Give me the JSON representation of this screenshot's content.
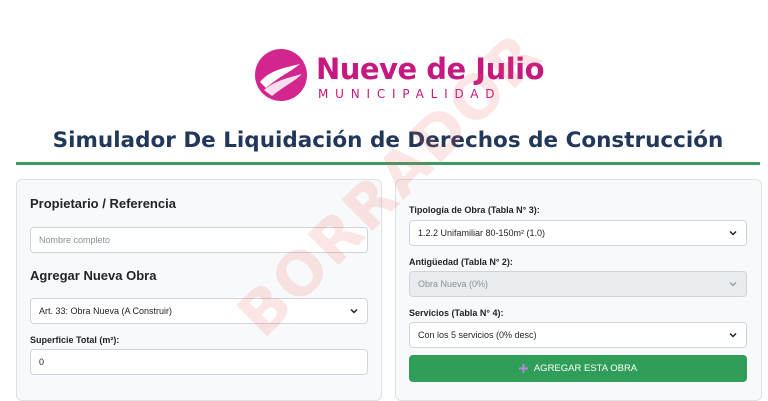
{
  "brand": {
    "name": "Nueve de Julio",
    "subtitle": "MUNICIPALIDAD",
    "color": "#c51880"
  },
  "page": {
    "title": "Simulador De Liquidación de Derechos de Construcción",
    "title_color": "#22385a",
    "accent": "#3c9a5f"
  },
  "watermark": "BORRADOR",
  "left": {
    "owner_heading": "Propietario / Referencia",
    "owner_placeholder": "Nombre completo",
    "add_heading": "Agregar Nueva Obra",
    "work_type": {
      "value": "Art. 33: Obra Nueva (A Construir)"
    },
    "area": {
      "label": "Superficie Total (m²):",
      "value": "0"
    }
  },
  "right": {
    "typology": {
      "label": "Tipología de Obra (Tabla N° 3):",
      "value": "1.2.2 Unifamiliar 80-150m² (1.0)"
    },
    "age": {
      "label": "Antigüedad (Tabla N° 2):",
      "value": "Obra Nueva (0%)"
    },
    "services": {
      "label": "Servicios (Tabla N° 4):",
      "value": "Con los 5 servicios (0% desc)"
    },
    "add_button": {
      "label": "AGREGAR ESTA OBRA",
      "color": "#2f9e58"
    }
  }
}
